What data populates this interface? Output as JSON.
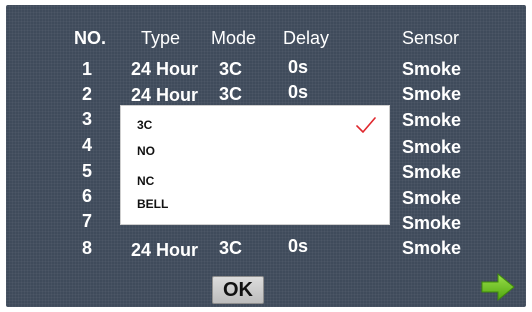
{
  "table": {
    "headers": {
      "no": "NO.",
      "type": "Type",
      "mode": "Mode",
      "delay": "Delay",
      "sensor": "Sensor"
    },
    "rows": [
      {
        "no": "1",
        "type": "24 Hour",
        "mode": "3C",
        "delay": "0s",
        "sensor": "Smoke"
      },
      {
        "no": "2",
        "type": "24 Hour",
        "mode": "3C",
        "delay": "0s",
        "sensor": "Smoke"
      },
      {
        "no": "3",
        "type": "",
        "mode": "",
        "delay": "",
        "sensor": "Smoke"
      },
      {
        "no": "4",
        "type": "",
        "mode": "",
        "delay": "",
        "sensor": "Smoke"
      },
      {
        "no": "5",
        "type": "",
        "mode": "",
        "delay": "",
        "sensor": "Smoke"
      },
      {
        "no": "6",
        "type": "",
        "mode": "",
        "delay": "",
        "sensor": "Smoke"
      },
      {
        "no": "7",
        "type": "",
        "mode": "",
        "delay": "",
        "sensor": "Smoke"
      },
      {
        "no": "8",
        "type": "24 Hour",
        "mode": "3C",
        "delay": "0s",
        "sensor": "Smoke"
      }
    ]
  },
  "mode_dropdown": {
    "options": [
      "3C",
      "NO",
      "NC",
      "BELL"
    ],
    "selected": "3C",
    "check_icon": "checkmark-icon",
    "check_color": "#e0282e"
  },
  "buttons": {
    "ok_label": "OK",
    "next_icon": "arrow-right-icon",
    "next_color": "#6cc51b"
  },
  "colors": {
    "background": "#3f4b5b",
    "text": "#ffffff"
  }
}
